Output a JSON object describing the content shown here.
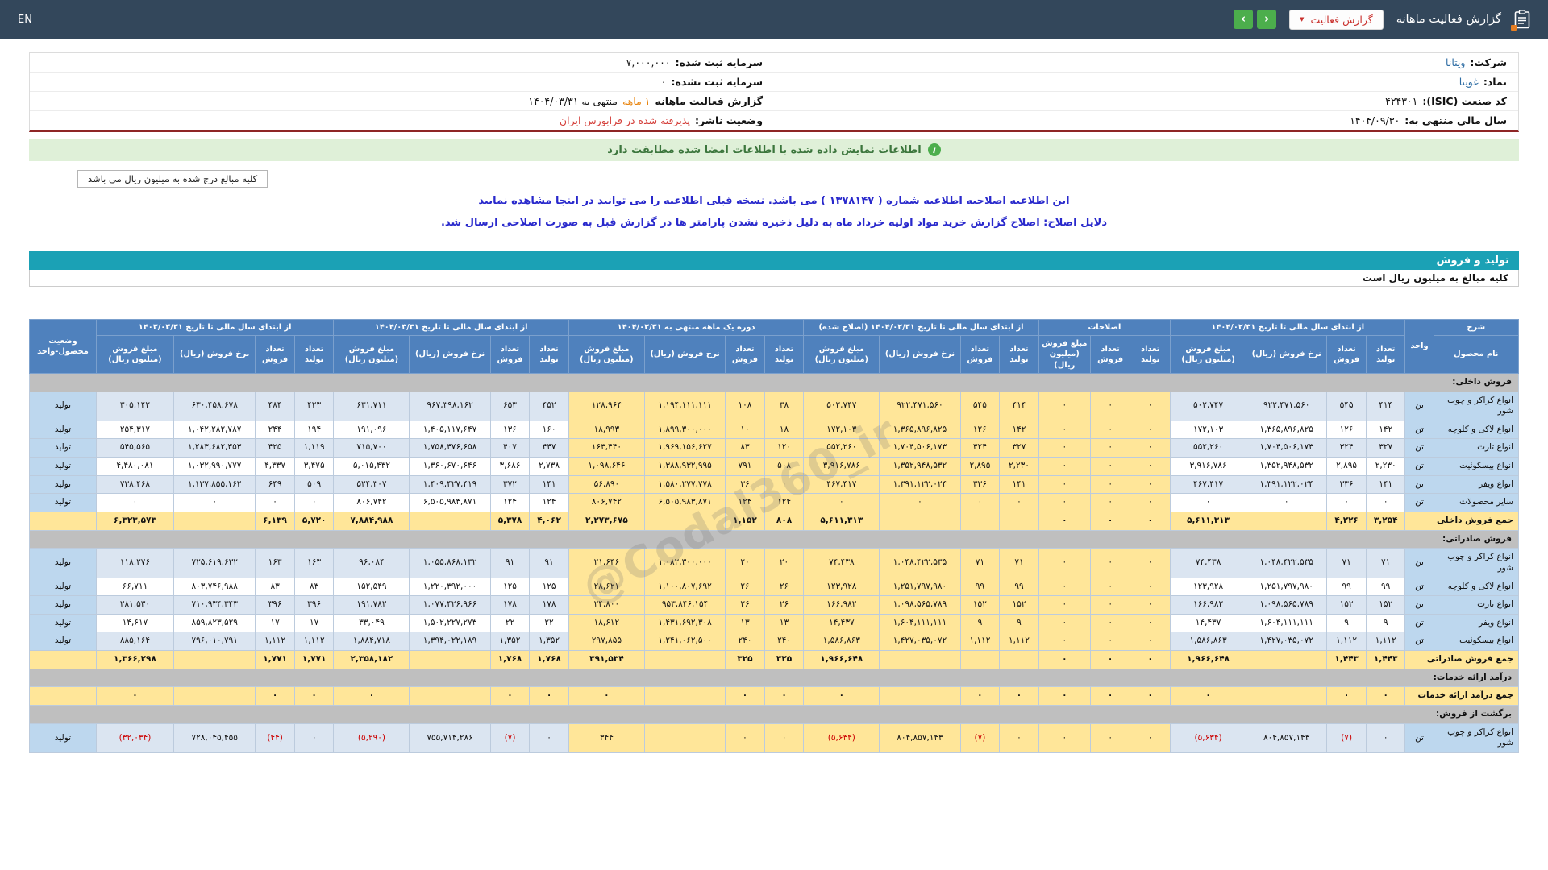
{
  "topbar": {
    "title": "گزارش فعالیت ماهانه",
    "report_select": "گزارش فعالیت",
    "en": "EN"
  },
  "info": {
    "company_label": "شرکت:",
    "company": "ویتانا",
    "symbol_label": "نماد:",
    "symbol": "غویتا",
    "isic_label": "کد صنعت (ISIC):",
    "isic": "۴۲۴۳۰۱",
    "fiscal_label": "سال مالی منتهی به:",
    "fiscal": "۱۴۰۴/۰۹/۳۰",
    "cap_reg_label": "سرمایه ثبت شده:",
    "cap_reg": "۷,۰۰۰,۰۰۰",
    "cap_unreg_label": "سرمایه ثبت نشده:",
    "cap_unreg": "۰",
    "period_label": "گزارش فعالیت ماهانه",
    "period_len": "۱ ماهه",
    "period_rest": "منتهی به ۱۴۰۴/۰۳/۳۱",
    "issuer_label": "وضعیت ناشر:",
    "issuer": "پذیرفته شده در فرابورس ایران"
  },
  "banners": {
    "signed": "اطلاعات نمایش داده شده با اطلاعات امضا شده مطابقت دارد",
    "amounts_note": "کلیه مبالغ درج شده به میلیون ریال می باشد",
    "revision_pre": "این اطلاعیه اصلاحیه اطلاعیه شماره ( ۱۳۷۸۱۴۷ ) می باشد. نسخه قبلی اطلاعیه را می توانید در",
    "revision_link": "اینجا",
    "revision_post": "مشاهده نمایید",
    "revision_reason": "دلایل اصلاح: اصلاح گزارش خرید مواد اولیه خرداد ماه به دلیل ذخیره نشدن پارامتر ها در گزارش قبل به صورت اصلاحی ارسال شد."
  },
  "section": {
    "title": "تولید و فروش",
    "amounts_line": "کلیه مبالغ به میلیون ریال است"
  },
  "watermark": "@Codal360_ir",
  "colors": {
    "topbar": "#33475b",
    "header_blue": "#4f81bd",
    "highlight_yellow": "#ffe699",
    "zebra_blue": "#dbe5f1",
    "fixed_blue": "#bdd7ee",
    "section_gray": "#bfbfbf",
    "negative_red": "#cc0000",
    "teal": "#1ba1b5",
    "green": "#4cae4c",
    "link_blue": "#2e6da4"
  },
  "table": {
    "header": {
      "desc": "شرح",
      "product": "نام محصول",
      "unit": "واحد",
      "status": "وضعیت محصول-واحد",
      "groups": [
        {
          "label": "از ابتدای سال مالی تا تاریخ ۱۴۰۴/۰۲/۳۱",
          "cols": [
            "تعداد تولید",
            "تعداد فروش",
            "نرخ فروش (ریال)",
            "مبلغ فروش (میلیون ریال)"
          ]
        },
        {
          "label": "اصلاحات",
          "cols": [
            "تعداد تولید",
            "تعداد فروش",
            "مبلغ فروش (میلیون ریال)"
          ]
        },
        {
          "label": "از ابتدای سال مالی تا تاریخ ۱۴۰۴/۰۲/۳۱ (اصلاح شده)",
          "cols": [
            "تعداد تولید",
            "تعداد فروش",
            "نرخ فروش (ریال)",
            "مبلغ فروش (میلیون ریال)"
          ]
        },
        {
          "label": "دوره یک ماهه منتهی به ۱۴۰۴/۰۳/۳۱",
          "cols": [
            "تعداد تولید",
            "تعداد فروش",
            "نرخ فروش (ریال)",
            "مبلغ فروش (میلیون ریال)"
          ]
        },
        {
          "label": "از ابتدای سال مالی تا تاریخ ۱۴۰۴/۰۳/۳۱",
          "cols": [
            "تعداد تولید",
            "تعداد فروش",
            "نرخ فروش (ریال)",
            "مبلغ فروش (میلیون ریال)"
          ]
        },
        {
          "label": "از ابتدای سال مالی تا تاریخ ۱۴۰۳/۰۳/۳۱",
          "cols": [
            "تعداد تولید",
            "تعداد فروش",
            "نرخ فروش (ریال)",
            "مبلغ فروش (میلیون ریال)"
          ]
        }
      ]
    },
    "rows": [
      {
        "type": "section",
        "name": "فروش داخلی:"
      },
      {
        "type": "product",
        "name": "انواع کراکر و چوب شور",
        "unit": "تن",
        "status": "تولید",
        "c": [
          "۴۱۴",
          "۵۴۵",
          "۹۲۲,۴۷۱,۵۶۰",
          "۵۰۲,۷۴۷",
          "۰",
          "۰",
          "۰",
          "۴۱۴",
          "۵۴۵",
          "۹۲۲,۴۷۱,۵۶۰",
          "۵۰۲,۷۴۷",
          "۳۸",
          "۱۰۸",
          "۱,۱۹۴,۱۱۱,۱۱۱",
          "۱۲۸,۹۶۴",
          "۴۵۲",
          "۶۵۳",
          "۹۶۷,۳۹۸,۱۶۲",
          "۶۳۱,۷۱۱",
          "۴۲۳",
          "۴۸۴",
          "۶۳۰,۴۵۸,۶۷۸",
          "۳۰۵,۱۴۲"
        ]
      },
      {
        "type": "product",
        "name": "انواع لاکی و کلوچه",
        "unit": "تن",
        "status": "تولید",
        "c": [
          "۱۴۲",
          "۱۲۶",
          "۱,۳۶۵,۸۹۶,۸۲۵",
          "۱۷۲,۱۰۳",
          "۰",
          "۰",
          "۰",
          "۱۴۲",
          "۱۲۶",
          "۱,۳۶۵,۸۹۶,۸۲۵",
          "۱۷۲,۱۰۳",
          "۱۸",
          "۱۰",
          "۱,۸۹۹,۳۰۰,۰۰۰",
          "۱۸,۹۹۳",
          "۱۶۰",
          "۱۳۶",
          "۱,۴۰۵,۱۱۷,۶۴۷",
          "۱۹۱,۰۹۶",
          "۱۹۴",
          "۲۴۴",
          "۱,۰۴۲,۲۸۲,۷۸۷",
          "۲۵۴,۳۱۷"
        ]
      },
      {
        "type": "product",
        "name": "انواع تارت",
        "unit": "تن",
        "status": "تولید",
        "c": [
          "۳۲۷",
          "۳۲۴",
          "۱,۷۰۴,۵۰۶,۱۷۳",
          "۵۵۲,۲۶۰",
          "۰",
          "۰",
          "۰",
          "۳۲۷",
          "۳۲۴",
          "۱,۷۰۴,۵۰۶,۱۷۳",
          "۵۵۲,۲۶۰",
          "۱۲۰",
          "۸۳",
          "۱,۹۶۹,۱۵۶,۶۲۷",
          "۱۶۳,۴۴۰",
          "۴۴۷",
          "۴۰۷",
          "۱,۷۵۸,۴۷۶,۶۵۸",
          "۷۱۵,۷۰۰",
          "۱,۱۱۹",
          "۴۲۵",
          "۱,۲۸۳,۶۸۲,۳۵۳",
          "۵۴۵,۵۶۵"
        ]
      },
      {
        "type": "product",
        "name": "انواع بیسکوئیت",
        "unit": "تن",
        "status": "تولید",
        "c": [
          "۲,۲۳۰",
          "۲,۸۹۵",
          "۱,۳۵۲,۹۴۸,۵۳۲",
          "۳,۹۱۶,۷۸۶",
          "۰",
          "۰",
          "۰",
          "۲,۲۳۰",
          "۲,۸۹۵",
          "۱,۳۵۲,۹۴۸,۵۳۲",
          "۳,۹۱۶,۷۸۶",
          "۵۰۸",
          "۷۹۱",
          "۱,۳۸۸,۹۳۲,۹۹۵",
          "۱,۰۹۸,۶۴۶",
          "۲,۷۳۸",
          "۳,۶۸۶",
          "۱,۳۶۰,۶۷۰,۶۴۶",
          "۵,۰۱۵,۴۳۲",
          "۳,۴۷۵",
          "۴,۳۳۷",
          "۱,۰۳۲,۹۹۰,۷۷۷",
          "۴,۴۸۰,۰۸۱"
        ]
      },
      {
        "type": "product",
        "name": "انواع ویفر",
        "unit": "تن",
        "status": "تولید",
        "c": [
          "۱۴۱",
          "۳۳۶",
          "۱,۳۹۱,۱۲۲,۰۲۴",
          "۴۶۷,۴۱۷",
          "۰",
          "۰",
          "۰",
          "۱۴۱",
          "۳۳۶",
          "۱,۳۹۱,۱۲۲,۰۲۴",
          "۴۶۷,۴۱۷",
          "۰",
          "۳۶",
          "۱,۵۸۰,۲۷۷,۷۷۸",
          "۵۶,۸۹۰",
          "۱۴۱",
          "۳۷۲",
          "۱,۴۰۹,۴۲۷,۴۱۹",
          "۵۲۴,۳۰۷",
          "۵۰۹",
          "۶۴۹",
          "۱,۱۳۷,۸۵۵,۱۶۲",
          "۷۳۸,۴۶۸"
        ]
      },
      {
        "type": "product",
        "name": "سایر محصولات",
        "unit": "تن",
        "status": "تولید",
        "c": [
          "۰",
          "۰",
          "۰",
          "۰",
          "۰",
          "۰",
          "۰",
          "۰",
          "۰",
          "۰",
          "۰",
          "۱۲۴",
          "۱۲۴",
          "۶,۵۰۵,۹۸۳,۸۷۱",
          "۸۰۶,۷۴۲",
          "۱۲۴",
          "۱۲۴",
          "۶,۵۰۵,۹۸۳,۸۷۱",
          "۸۰۶,۷۴۲",
          "۰",
          "۰",
          "۰",
          "۰"
        ]
      },
      {
        "type": "total",
        "name": "جمع فروش داخلی",
        "status": "",
        "c": [
          "۳,۲۵۴",
          "۴,۲۲۶",
          "",
          "۵,۶۱۱,۳۱۳",
          "۰",
          "۰",
          "۰",
          "",
          "",
          "",
          "۵,۶۱۱,۳۱۳",
          "۸۰۸",
          "۱,۱۵۲",
          "",
          "۲,۲۷۳,۶۷۵",
          "۴,۰۶۲",
          "۵,۳۷۸",
          "",
          "۷,۸۸۴,۹۸۸",
          "۵,۷۲۰",
          "۶,۱۳۹",
          "",
          "۶,۳۲۳,۵۷۳"
        ]
      },
      {
        "type": "section",
        "name": "فروش صادراتی:"
      },
      {
        "type": "product",
        "name": "انواع کراکر و چوب شور",
        "unit": "تن",
        "status": "تولید",
        "c": [
          "۷۱",
          "۷۱",
          "۱,۰۴۸,۴۲۲,۵۳۵",
          "۷۴,۴۳۸",
          "۰",
          "۰",
          "۰",
          "۷۱",
          "۷۱",
          "۱,۰۴۸,۴۲۲,۵۳۵",
          "۷۴,۴۳۸",
          "۲۰",
          "۲۰",
          "۱,۰۸۲,۳۰۰,۰۰۰",
          "۲۱,۶۴۶",
          "۹۱",
          "۹۱",
          "۱,۰۵۵,۸۶۸,۱۳۲",
          "۹۶,۰۸۴",
          "۱۶۳",
          "۱۶۳",
          "۷۲۵,۶۱۹,۶۳۲",
          "۱۱۸,۲۷۶"
        ]
      },
      {
        "type": "product",
        "name": "انواع لاکی و کلوچه",
        "unit": "تن",
        "status": "تولید",
        "c": [
          "۹۹",
          "۹۹",
          "۱,۲۵۱,۷۹۷,۹۸۰",
          "۱۲۳,۹۲۸",
          "۰",
          "۰",
          "۰",
          "۹۹",
          "۹۹",
          "۱,۲۵۱,۷۹۷,۹۸۰",
          "۱۲۳,۹۲۸",
          "۲۶",
          "۲۶",
          "۱,۱۰۰,۸۰۷,۶۹۲",
          "۲۸,۶۲۱",
          "۱۲۵",
          "۱۲۵",
          "۱,۲۲۰,۳۹۲,۰۰۰",
          "۱۵۲,۵۴۹",
          "۸۳",
          "۸۳",
          "۸۰۳,۷۴۶,۹۸۸",
          "۶۶,۷۱۱"
        ]
      },
      {
        "type": "product",
        "name": "انواع تارت",
        "unit": "تن",
        "status": "تولید",
        "c": [
          "۱۵۲",
          "۱۵۲",
          "۱,۰۹۸,۵۶۵,۷۸۹",
          "۱۶۶,۹۸۲",
          "۰",
          "۰",
          "۰",
          "۱۵۲",
          "۱۵۲",
          "۱,۰۹۸,۵۶۵,۷۸۹",
          "۱۶۶,۹۸۲",
          "۲۶",
          "۲۶",
          "۹۵۳,۸۴۶,۱۵۴",
          "۲۴,۸۰۰",
          "۱۷۸",
          "۱۷۸",
          "۱,۰۷۷,۴۲۶,۹۶۶",
          "۱۹۱,۷۸۲",
          "۳۹۶",
          "۳۹۶",
          "۷۱۰,۹۳۴,۳۴۳",
          "۲۸۱,۵۳۰"
        ]
      },
      {
        "type": "product",
        "name": "انواع ویفر",
        "unit": "تن",
        "status": "تولید",
        "c": [
          "۹",
          "۹",
          "۱,۶۰۴,۱۱۱,۱۱۱",
          "۱۴,۴۳۷",
          "۰",
          "۰",
          "۰",
          "۹",
          "۹",
          "۱,۶۰۴,۱۱۱,۱۱۱",
          "۱۴,۴۳۷",
          "۱۳",
          "۱۳",
          "۱,۴۳۱,۶۹۲,۳۰۸",
          "۱۸,۶۱۲",
          "۲۲",
          "۲۲",
          "۱,۵۰۲,۲۲۷,۲۷۳",
          "۳۳,۰۴۹",
          "۱۷",
          "۱۷",
          "۸۵۹,۸۲۳,۵۲۹",
          "۱۴,۶۱۷"
        ]
      },
      {
        "type": "product",
        "name": "انواع بیسکوئیت",
        "unit": "تن",
        "status": "تولید",
        "c": [
          "۱,۱۱۲",
          "۱,۱۱۲",
          "۱,۴۲۷,۰۳۵,۰۷۲",
          "۱,۵۸۶,۸۶۳",
          "۰",
          "۰",
          "۰",
          "۱,۱۱۲",
          "۱,۱۱۲",
          "۱,۴۲۷,۰۳۵,۰۷۲",
          "۱,۵۸۶,۸۶۳",
          "۲۴۰",
          "۲۴۰",
          "۱,۲۴۱,۰۶۲,۵۰۰",
          "۲۹۷,۸۵۵",
          "۱,۳۵۲",
          "۱,۳۵۲",
          "۱,۳۹۴,۰۲۲,۱۸۹",
          "۱,۸۸۴,۷۱۸",
          "۱,۱۱۲",
          "۱,۱۱۲",
          "۷۹۶,۰۱۰,۷۹۱",
          "۸۸۵,۱۶۴"
        ]
      },
      {
        "type": "total",
        "name": "جمع فروش صادراتی",
        "status": "",
        "c": [
          "۱,۴۴۳",
          "۱,۴۴۳",
          "",
          "۱,۹۶۶,۶۴۸",
          "۰",
          "۰",
          "۰",
          "",
          "",
          "",
          "۱,۹۶۶,۶۴۸",
          "۳۲۵",
          "۳۲۵",
          "",
          "۳۹۱,۵۳۴",
          "۱,۷۶۸",
          "۱,۷۶۸",
          "",
          "۲,۳۵۸,۱۸۲",
          "۱,۷۷۱",
          "۱,۷۷۱",
          "",
          "۱,۳۶۶,۲۹۸"
        ]
      },
      {
        "type": "section",
        "name": "درآمد ارائه خدمات:"
      },
      {
        "type": "total",
        "name": "جمع درآمد ارائه خدمات",
        "status": "",
        "c": [
          "۰",
          "۰",
          "",
          "۰",
          "۰",
          "۰",
          "۰",
          "۰",
          "۰",
          "",
          "۰",
          "۰",
          "۰",
          "",
          "۰",
          "۰",
          "۰",
          "",
          "۰",
          "۰",
          "۰",
          "",
          "۰"
        ]
      },
      {
        "type": "section",
        "name": "برگشت از فروش:"
      },
      {
        "type": "product",
        "name": "انواع کراکر و چوب شور",
        "unit": "تن",
        "status": "تولید",
        "c": [
          "۰",
          "(۷)",
          "۸۰۴,۸۵۷,۱۴۳",
          "(۵,۶۳۴)",
          "۰",
          "۰",
          "۰",
          "۰",
          "(۷)",
          "۸۰۴,۸۵۷,۱۴۳",
          "(۵,۶۳۴)",
          "۰",
          "۰",
          "",
          "۳۴۴",
          "۰",
          "(۷)",
          "۷۵۵,۷۱۴,۲۸۶",
          "(۵,۲۹۰)",
          "۰",
          "(۴۴)",
          "۷۲۸,۰۴۵,۴۵۵",
          "(۳۲,۰۳۴)"
        ]
      }
    ]
  }
}
